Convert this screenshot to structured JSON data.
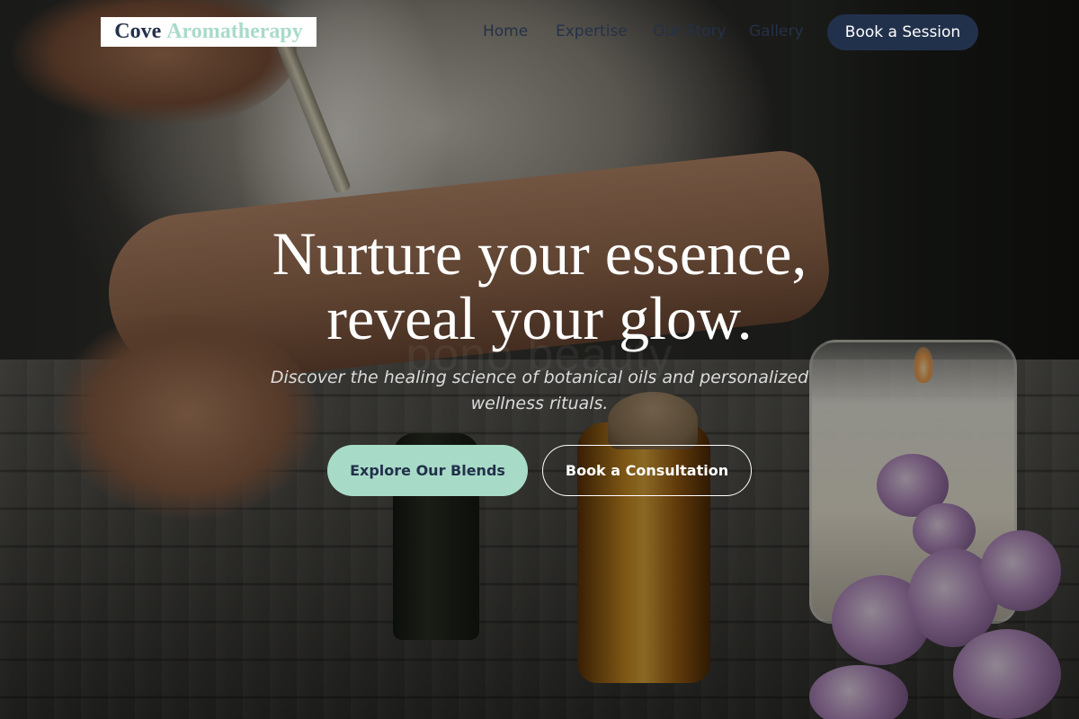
{
  "header": {
    "logo_word1": "Cove",
    "logo_word2": "Aromatherapy",
    "nav": [
      {
        "label": "Home"
      },
      {
        "label": "Expertise"
      },
      {
        "label": "Our Story"
      },
      {
        "label": "Gallery"
      }
    ],
    "cta_label": "Book a Session"
  },
  "hero": {
    "headline_line1": "Nurture your essence,",
    "headline_line2": "reveal your glow.",
    "subtitle": "Discover the healing science of botanical oils and personalized wellness rituals.",
    "primary_button": "Explore Our Blends",
    "secondary_button": "Book a Consultation",
    "background_watermark": "pono beauty"
  },
  "colors": {
    "navy": "#22314b",
    "mint": "#a8dbc7",
    "white": "#ffffff"
  }
}
